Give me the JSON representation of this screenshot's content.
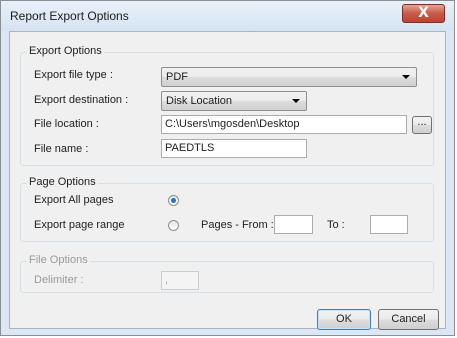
{
  "window": {
    "title": "Report Export Options",
    "close_glyph": "X"
  },
  "export_options": {
    "group_title": "Export Options",
    "file_type_label": "Export file type :",
    "file_type_value": "PDF",
    "destination_label": "Export destination :",
    "destination_value": "Disk Location",
    "file_location_label": "File location :",
    "file_location_value": "C:\\Users\\mgosden\\Desktop",
    "browse_label": "...",
    "file_name_label": "File name :",
    "file_name_value": "PAEDTLS"
  },
  "page_options": {
    "group_title": "Page Options",
    "all_pages_label": "Export All pages",
    "all_pages_selected": true,
    "page_range_label": "Export page range",
    "page_range_selected": false,
    "from_label": "Pages - From :",
    "from_value": "",
    "to_label": "To :",
    "to_value": ""
  },
  "file_options": {
    "group_title": "File Options",
    "delimiter_label": "Delimiter :",
    "delimiter_value": ","
  },
  "buttons": {
    "ok": "OK",
    "cancel": "Cancel"
  },
  "colors": {
    "radio_dot": "#2a6fc0",
    "close_button": "#c75a48",
    "frame": "#dbe7f4"
  }
}
